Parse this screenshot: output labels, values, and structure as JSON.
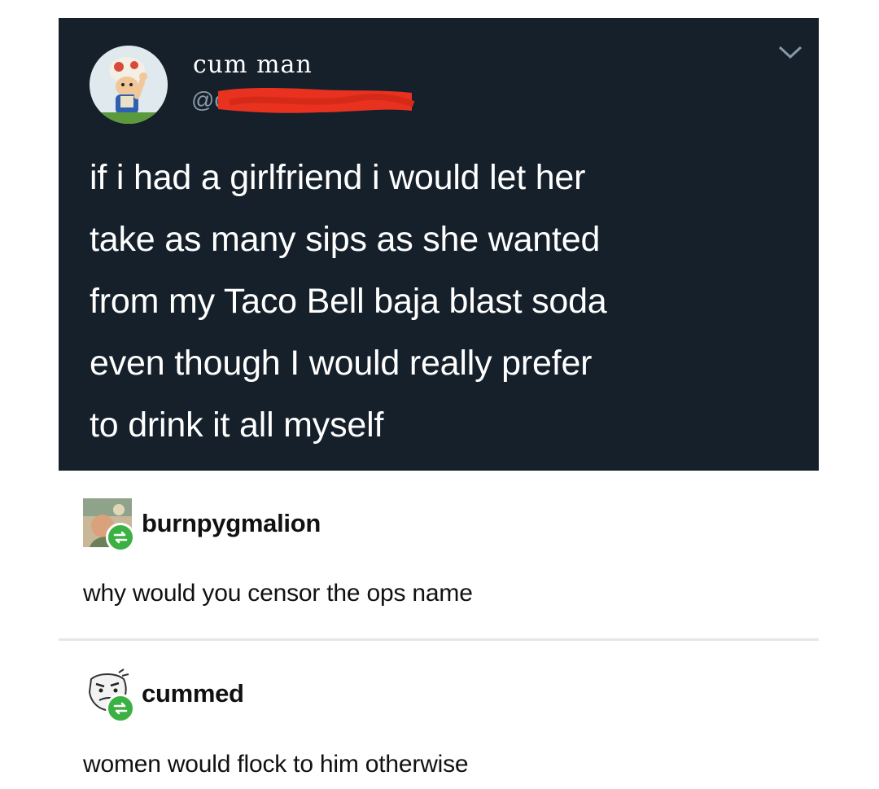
{
  "tweet": {
    "display_name": "cum man",
    "handle_visible": "@c",
    "avatar_icon": "cartoon-character-avatar",
    "menu_icon": "chevron-down-icon",
    "text_lines": [
      "if i had a girlfriend i would let her",
      "take as many sips as she wanted",
      "from my Taco Bell baja blast soda",
      "even though I would really prefer",
      "to drink it all myself"
    ],
    "colors": {
      "background": "#15202b",
      "handle": "#8899a6",
      "redaction": "#e8321f"
    }
  },
  "reblogs": [
    {
      "username": "burnpygmalion",
      "text": "why would you censor the ops name",
      "avatar_icon": "illustrated-avatar",
      "badge_icon": "reblog-icon"
    },
    {
      "username": "cummed",
      "text": "women would flock to him otherwise",
      "avatar_icon": "meme-face-avatar",
      "badge_icon": "reblog-icon"
    }
  ],
  "colors": {
    "reblog_badge": "#3bb143",
    "divider": "#e6e6e6"
  }
}
